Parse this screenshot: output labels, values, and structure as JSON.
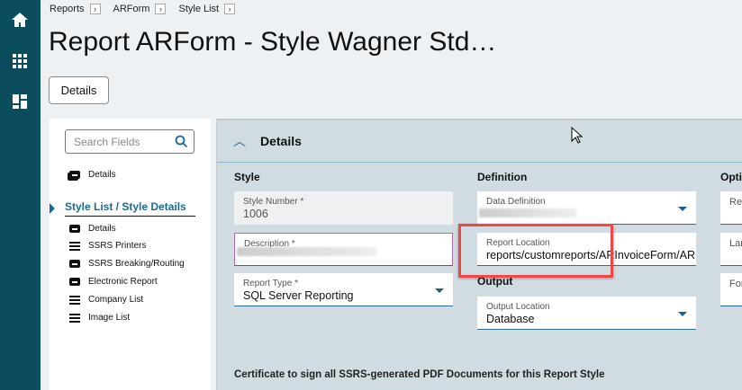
{
  "breadcrumbs": [
    "Reports",
    "ARForm",
    "Style List"
  ],
  "title": "Report ARForm - Style Wagner Std…",
  "details_button": "Details",
  "left": {
    "search_placeholder": "Search Fields",
    "top_item": "Details",
    "section": "Style List / Style Details",
    "items": [
      {
        "label": "Details",
        "icon": "form-icon"
      },
      {
        "label": "SSRS Printers",
        "icon": "list-icon"
      },
      {
        "label": "SSRS Breaking/Routing",
        "icon": "form-icon"
      },
      {
        "label": "Electronic Report",
        "icon": "form-icon"
      },
      {
        "label": "Company List",
        "icon": "list-icon"
      },
      {
        "label": "Image List",
        "icon": "list-icon"
      }
    ]
  },
  "panel": {
    "title": "Details",
    "style": {
      "heading": "Style",
      "style_number_label": "Style Number *",
      "style_number": "1006",
      "description_label": "Description *",
      "report_type_label": "Report Type *",
      "report_type": "SQL Server Reporting"
    },
    "definition": {
      "heading": "Definition",
      "data_def_label": "Data Definition",
      "report_location_label": "Report Location",
      "report_location": "reports/customreports/ARInvoiceForm/AR…"
    },
    "output": {
      "heading": "Output",
      "output_location_label": "Output Location",
      "output_location": "Database"
    },
    "options": {
      "heading": "Optio",
      "f1": "Rep",
      "f2": "Lan",
      "f3": "For"
    },
    "certificate": "Certificate to sign all SSRS-generated PDF Documents for this Report Style"
  },
  "colors": {
    "rail": "#0b4d5c",
    "accent": "#1a6a96",
    "highlight": "#f04848"
  }
}
